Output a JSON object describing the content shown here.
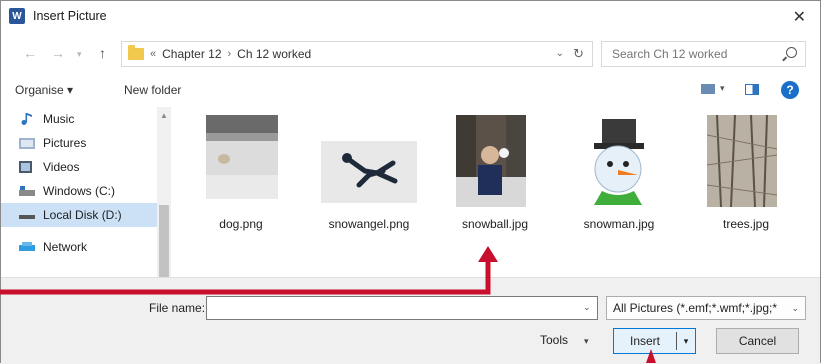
{
  "window": {
    "title": "Insert Picture",
    "app_icon_letter": "W"
  },
  "address_bar": {
    "breadcrumb_prefix": "«",
    "breadcrumbs": [
      "Chapter 12",
      "Ch 12 worked"
    ],
    "separator": "›"
  },
  "search": {
    "placeholder": "Search Ch 12 worked"
  },
  "toolbar": {
    "organise_label": "Organise ▾",
    "new_folder_label": "New folder",
    "help_label": "?"
  },
  "nav_pane": {
    "items": [
      {
        "label": "Music",
        "icon": "music-note-icon"
      },
      {
        "label": "Pictures",
        "icon": "pictures-folder-icon"
      },
      {
        "label": "Videos",
        "icon": "videos-folder-icon"
      },
      {
        "label": "Windows (C:)",
        "icon": "drive-c-icon"
      },
      {
        "label": "Local Disk (D:)",
        "icon": "drive-d-icon",
        "selected": true
      },
      {
        "label": "Network",
        "icon": "network-icon"
      }
    ]
  },
  "files": [
    {
      "name": "dog.png"
    },
    {
      "name": "snowangel.png"
    },
    {
      "name": "snowball.jpg"
    },
    {
      "name": "snowman.jpg"
    },
    {
      "name": "trees.jpg"
    }
  ],
  "bottom": {
    "file_name_label": "File name:",
    "file_name_value": "",
    "filter_label": "All Pictures (*.emf;*.wmf;*.jpg;*",
    "tools_label": "Tools",
    "insert_label": "Insert",
    "cancel_label": "Cancel"
  },
  "colors": {
    "accent": "#0078d7",
    "annotation_arrow": "#c8102e",
    "selection": "#cce1f5"
  }
}
